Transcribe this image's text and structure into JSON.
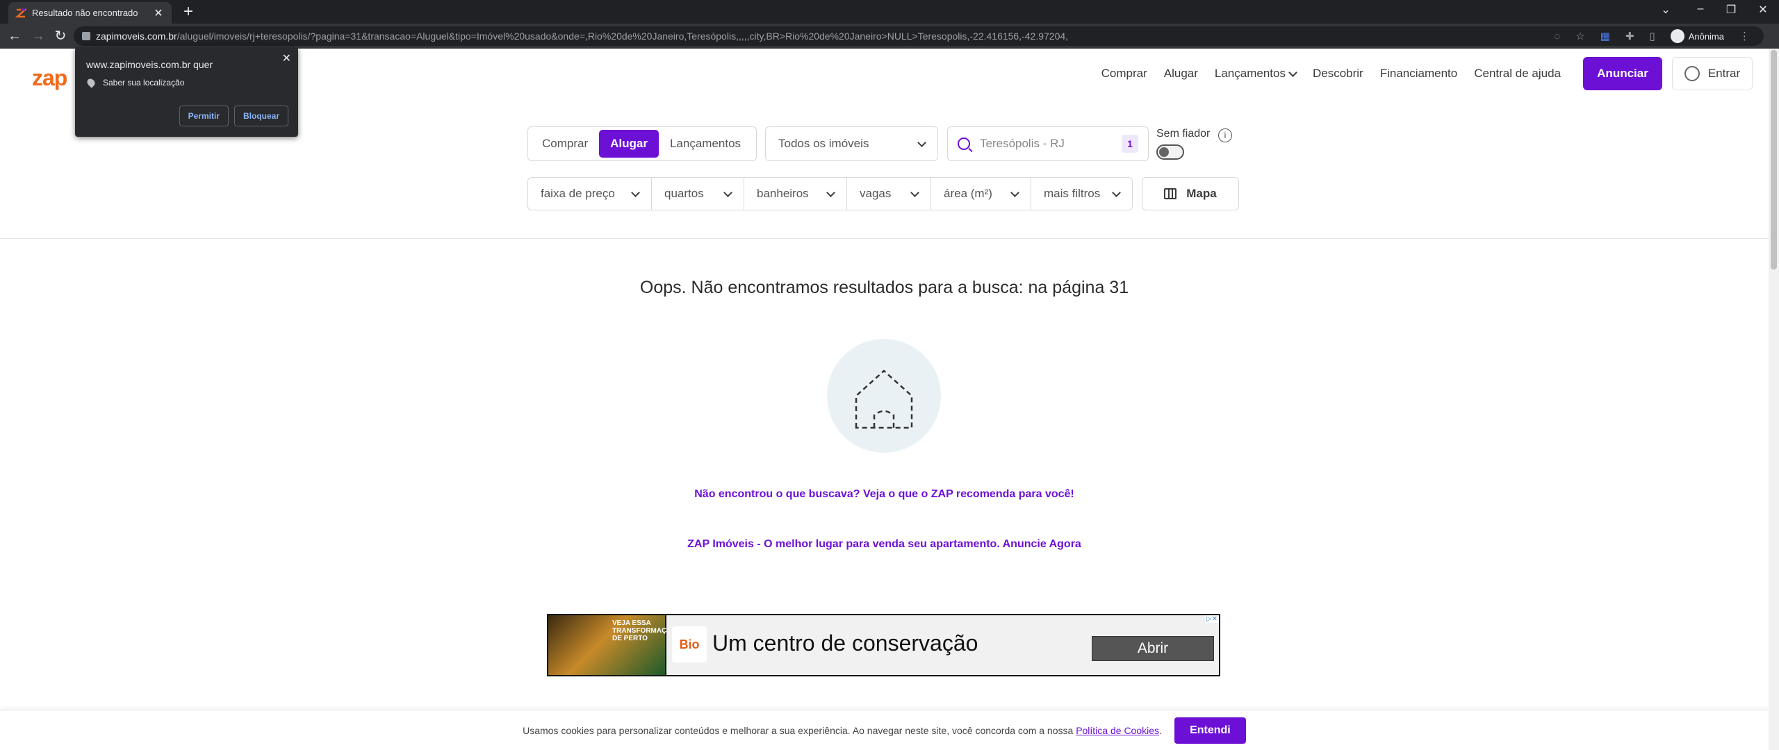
{
  "browser": {
    "tab_title": "Resultado não encontrado",
    "url_host": "zapimoveis.com.br",
    "url_path": "/aluguel/imoveis/rj+teresopolis/?pagina=31&transacao=Aluguel&tipo=Imóvel%20usado&onde=,Rio%20de%20Janeiro,Teresópolis,,,,,city,BR>Rio%20de%20Janeiro>NULL>Teresopolis,-22.416156,-42.97204,",
    "profile_label": "Anônima"
  },
  "permission_popup": {
    "title": "www.zapimoveis.com.br quer",
    "request": "Saber sua localização",
    "allow_label": "Permitir",
    "block_label": "Bloquear"
  },
  "header": {
    "logo_text": "zap",
    "nav": [
      "Comprar",
      "Alugar",
      "Lançamentos",
      "Descobrir",
      "Financiamento",
      "Central de ajuda"
    ],
    "anunciar_label": "Anunciar",
    "entrar_label": "Entrar"
  },
  "search": {
    "transaction_options": [
      "Comprar",
      "Alugar",
      "Lançamentos"
    ],
    "transaction_selected": "Alugar",
    "property_type": "Todos os imóveis",
    "location_value": "Teresópolis - RJ",
    "location_count": "1",
    "sem_fiador_label": "Sem fiador",
    "sem_fiador_on": false,
    "filters": [
      "faixa de preço",
      "quartos",
      "banheiros",
      "vagas",
      "área (m²)",
      "mais filtros"
    ],
    "mapa_label": "Mapa"
  },
  "results": {
    "empty_title": "Oops. Não encontramos resultados para a busca: na página 31",
    "recommend_link": "Não encontrou o que buscava? Veja o que o ZAP recomenda para você!",
    "promo_link": "ZAP Imóveis - O melhor lugar para venda seu apartamento. Anuncie Agora"
  },
  "ad": {
    "art_text": "VEJA ESSA TRANSFORMAÇÃO DE PERTO",
    "logo_text": "Bio",
    "headline": "Um centro de conservação",
    "cta": "Abrir"
  },
  "cookie": {
    "text": "Usamos cookies para personalizar conteúdos e melhorar a sua experiência. Ao navegar neste site, você concorda com a nossa",
    "link": "Política de Cookies",
    "link_suffix": ".",
    "button": "Entendi"
  },
  "colors": {
    "brand_purple": "#6d10d6",
    "brand_orange": "#f26a1b"
  }
}
